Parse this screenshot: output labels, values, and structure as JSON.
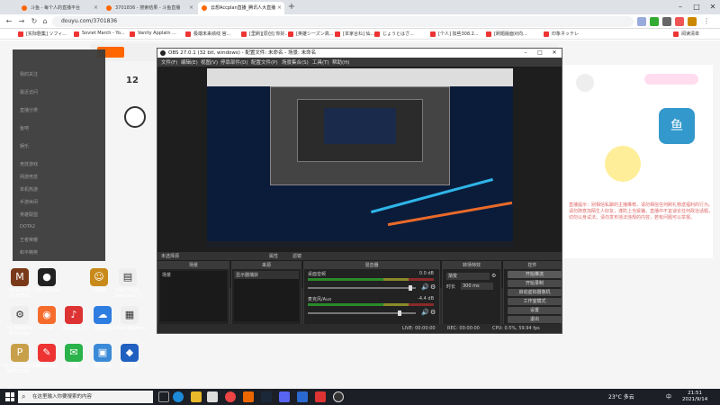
{
  "browser": {
    "tabs": [
      {
        "title": "斗鱼 - 每个人的直播平台",
        "active": false
      },
      {
        "title": "3701836 - 搜索结果 - 斗鱼直播",
        "active": false
      },
      {
        "title": "云想Accplan直播_腾讯人大直播",
        "active": true
      }
    ],
    "address": "douyu.com/3701836",
    "bookmarks": [
      "[实际剧集] ソフィ...",
      "Soviet March - Yo...",
      "Vanity Applatn ...",
      "极端未来绩线 官...",
      "[里刷][原创] 你好...",
      "[英雄シーズン高...",
      "[本家合ね] 仙...",
      "じょうとはざ...",
      "[个人] 加些308.2...",
      "[刷题版面对向...",
      "印象ネッテレ",
      "阅读清单"
    ],
    "page": {
      "sidebar_items": [
        "我的关注",
        "最近访问",
        "直播分类",
        "鱼吧",
        "娱乐",
        "竞技游戏",
        "网游竞技",
        "单机热游",
        "手游休闲",
        "英雄联盟",
        "DOTA2",
        "王者荣耀",
        "和平精英",
        "主机游戏",
        "QQ飞车",
        "CSGO",
        "DNF",
        "天天狼人",
        "音乐",
        "户外"
      ],
      "count": "12",
      "right_text": "直播提示：别相信私聊的主播推荐，请勿相信任何刷礼物送福利的行为。请勿随意加陌生人好友，谨防上当受骗，直播中不宜谈论任何政治话题，切勿以身试法，请勿发布违法违规的内容，若有问题可以举报。"
    }
  },
  "obs": {
    "title": "OBS 27.0.1 (32 bit, windows) - 配置文件: 未命名 - 场景: 未命名",
    "menu": [
      "文件(F)",
      "编辑(E)",
      "视图(V)",
      "停靠部件(D)",
      "配置文件(P)",
      "场景集合(S)",
      "工具(T)",
      "帮助(H)"
    ],
    "transition_bar": [
      "未选择源",
      "属性",
      "滤镜"
    ],
    "docks": {
      "scenes": {
        "title": "场景",
        "items": [
          "场景"
        ]
      },
      "sources": {
        "title": "来源",
        "items": [
          "显示器捕获"
        ]
      },
      "mixer": {
        "title": "混音器",
        "channels": [
          {
            "name": "桌面音频",
            "db": "0.0 dB"
          },
          {
            "name": "麦克风/Aux",
            "db": "-4.4 dB"
          }
        ]
      },
      "transitions": {
        "title": "转场特效",
        "type": "渐变",
        "duration_label": "时长",
        "duration": "300 ms"
      },
      "controls": {
        "title": "控件",
        "buttons": [
          "开始推流",
          "开始录制",
          "启动虚拟摄像机",
          "工作室模式",
          "设置",
          "退出"
        ]
      }
    },
    "status": {
      "live": "LIVE: 00:00:00",
      "rec": "REC: 00:00:00",
      "cpu": "CPU: 0.5%, 59.94 fps"
    }
  },
  "desktop_icons": [
    {
      "label": "MONSTER HUNTER",
      "color": "#7a3a1a"
    },
    {
      "label": "OBS Studio",
      "color": "#222"
    },
    {
      "label": "小猿搜",
      "color": "#c88a1a"
    },
    {
      "label": "Euro Truck Simulator 2",
      "color": "#eee"
    },
    {
      "label": "PC Building Simulator",
      "color": "#eee"
    },
    {
      "label": "Origin",
      "color": "#f56c2d"
    },
    {
      "label": "网易云音乐",
      "color": "#d33"
    },
    {
      "label": "百度网盘",
      "color": "#2e7de0"
    },
    {
      "label": "Cities Skylines",
      "color": "#eee"
    },
    {
      "label": "PLAYERUNKNOWN BATTLEGR...",
      "color": "#c8a04a"
    },
    {
      "label": "Pentablet",
      "color": "#e33"
    },
    {
      "label": "微信",
      "color": "#2ab34a"
    },
    {
      "label": "我的电脑",
      "color": "#3a8ad8"
    },
    {
      "label": "腾讯手游",
      "color": "#2060c0"
    }
  ],
  "taskbar": {
    "search_placeholder": "在这里输入你要搜索的内容",
    "weather": "23°C 多云",
    "time": "21:51",
    "date": "2021/9/14",
    "ime": "中"
  }
}
